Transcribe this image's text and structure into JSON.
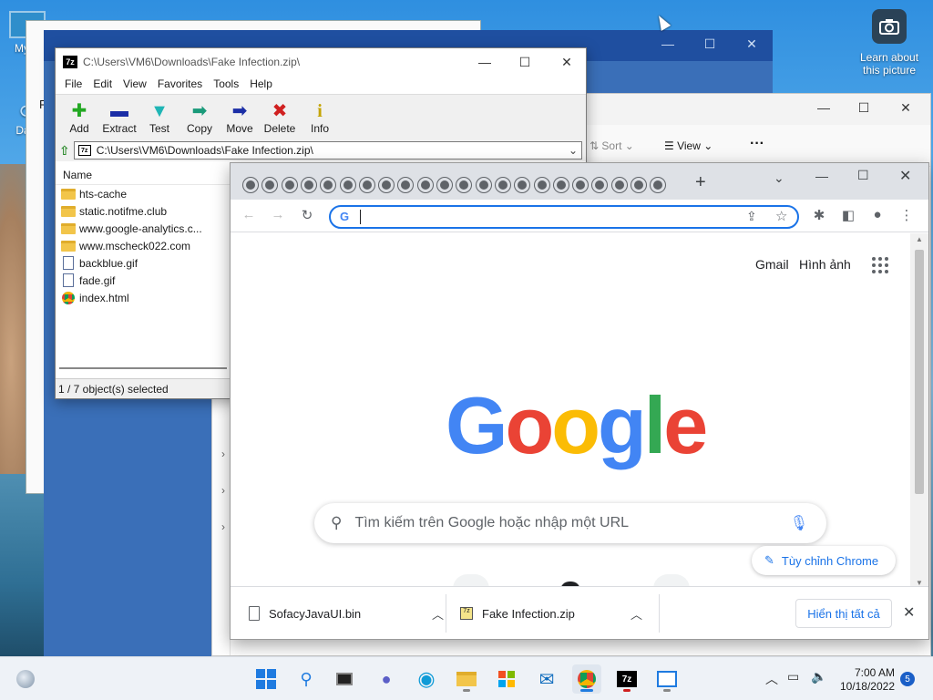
{
  "desktop": {
    "icons": [
      {
        "label": "My C",
        "icon": "monitor-icon"
      },
      {
        "label": "Data",
        "icon": "recycle-icon"
      }
    ],
    "learn_about": {
      "label_line1": "Learn about",
      "label_line2": "this picture",
      "icon": "camera-icon"
    }
  },
  "back_window": {
    "letter": "F"
  },
  "explorer": {
    "sort_label": "Sort",
    "view_label": "View",
    "more_label": "···",
    "partial_count": "6"
  },
  "sevenzip": {
    "title": "C:\\Users\\VM6\\Downloads\\Fake Infection.zip\\",
    "logo": "7z",
    "menu": [
      "File",
      "Edit",
      "View",
      "Favorites",
      "Tools",
      "Help"
    ],
    "toolbar": [
      {
        "label": "Add",
        "icon": "plus-icon",
        "glyph": "✚",
        "color": "#22a822"
      },
      {
        "label": "Extract",
        "icon": "minus-icon",
        "glyph": "▬",
        "color": "#1b2ea6"
      },
      {
        "label": "Test",
        "icon": "test-arrow-icon",
        "glyph": "▼",
        "color": "#1fb5b5"
      },
      {
        "label": "Copy",
        "icon": "copy-arrow-icon",
        "glyph": "➡",
        "color": "#1a9a7a"
      },
      {
        "label": "Move",
        "icon": "move-arrow-icon",
        "glyph": "➡",
        "color": "#1b2ea6"
      },
      {
        "label": "Delete",
        "icon": "delete-x-icon",
        "glyph": "✖",
        "color": "#d02020"
      },
      {
        "label": "Info",
        "icon": "info-icon",
        "glyph": "i",
        "color": "#c4a400"
      }
    ],
    "path": "C:\\Users\\VM6\\Downloads\\Fake Infection.zip\\",
    "column_name": "Name",
    "files": [
      {
        "name": "hts-cache",
        "type": "folder"
      },
      {
        "name": "static.notifme.club",
        "type": "folder"
      },
      {
        "name": "www.google-analytics.c...",
        "type": "folder"
      },
      {
        "name": "www.mscheck022.com",
        "type": "folder"
      },
      {
        "name": "backblue.gif",
        "type": "file"
      },
      {
        "name": "fade.gif",
        "type": "file"
      },
      {
        "name": "index.html",
        "type": "html"
      }
    ],
    "status": "1 / 7 object(s) selected"
  },
  "chrome": {
    "tab_count": 22,
    "new_tab": "+",
    "omnibox_value": "",
    "header_links": {
      "gmail": "Gmail",
      "images": "Hình ảnh"
    },
    "logo_letters": [
      {
        "ch": "G",
        "color": "#4285F4"
      },
      {
        "ch": "o",
        "color": "#EA4335"
      },
      {
        "ch": "o",
        "color": "#FBBC05"
      },
      {
        "ch": "g",
        "color": "#4285F4"
      },
      {
        "ch": "l",
        "color": "#34A853"
      },
      {
        "ch": "e",
        "color": "#EA4335"
      }
    ],
    "search_placeholder": "Tìm kiếm trên Google hoặc nhập một URL",
    "customize": "Tùy chỉnh Chrome",
    "downloads": [
      {
        "name": "SofacyJavaUI.bin",
        "icon": "file-icon"
      },
      {
        "name": "Fake Infection.zip",
        "icon": "zip-icon"
      }
    ],
    "show_all": "Hiển thị tất cả"
  },
  "taskbar": {
    "time": "7:00 AM",
    "date": "10/18/2022",
    "notifications": "5",
    "apps": [
      "start",
      "search",
      "task-view",
      "teams",
      "edge",
      "file-explorer",
      "store",
      "mail",
      "chrome",
      "7zip",
      "app"
    ]
  }
}
